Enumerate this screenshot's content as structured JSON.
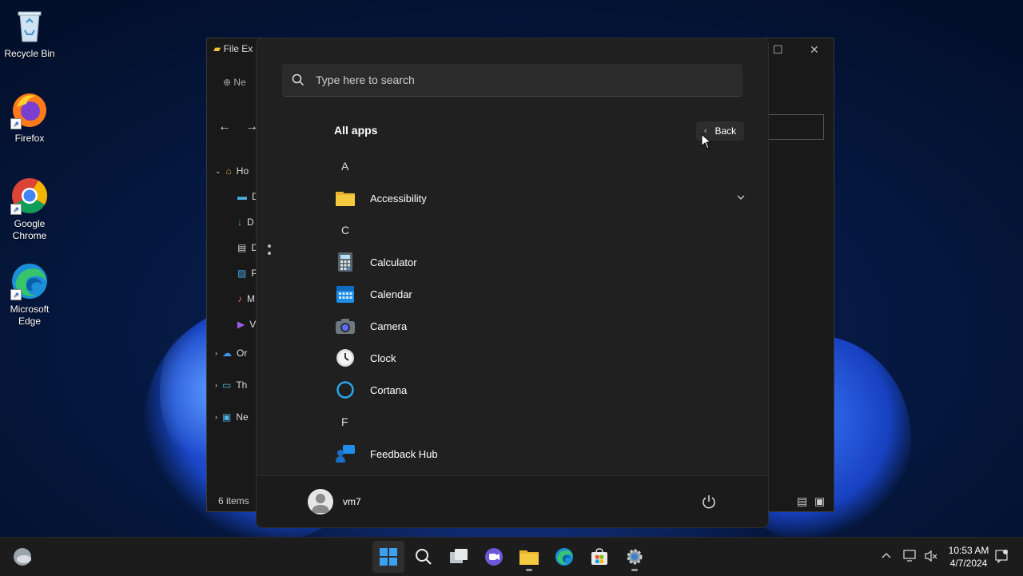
{
  "desktop": {
    "icons": [
      {
        "label": "Recycle Bin",
        "icon": "recycle-bin-icon"
      },
      {
        "label": "Firefox",
        "icon": "firefox-icon"
      },
      {
        "label": "Google Chrome",
        "icon": "chrome-icon"
      },
      {
        "label": "Microsoft Edge",
        "icon": "edge-icon"
      }
    ]
  },
  "explorer": {
    "title": "File Ex",
    "new_label": "Ne",
    "nav_items": [
      "Ho",
      "D",
      "D",
      "D",
      "P",
      "M",
      "V",
      "Or",
      "Th",
      "Ne"
    ],
    "status": "6 items"
  },
  "start_menu": {
    "search": {
      "placeholder": "Type here to search"
    },
    "title": "All apps",
    "back_label": "Back",
    "groups": [
      {
        "letter": "A",
        "apps": [
          {
            "name": "Accessibility",
            "icon": "folder-icon",
            "expandable": true
          }
        ]
      },
      {
        "letter": "C",
        "apps": [
          {
            "name": "Calculator",
            "icon": "calculator-icon"
          },
          {
            "name": "Calendar",
            "icon": "calendar-icon"
          },
          {
            "name": "Camera",
            "icon": "camera-icon"
          },
          {
            "name": "Clock",
            "icon": "clock-icon"
          },
          {
            "name": "Cortana",
            "icon": "cortana-icon"
          }
        ]
      },
      {
        "letter": "F",
        "apps": [
          {
            "name": "Feedback Hub",
            "icon": "feedback-hub-icon"
          }
        ]
      }
    ],
    "user": {
      "name": "vm7"
    }
  },
  "taskbar": {
    "apps": [
      "start",
      "search",
      "task-view",
      "teams-chat",
      "file-explorer",
      "edge",
      "microsoft-store",
      "settings"
    ],
    "time": "10:53 AM",
    "date": "4/7/2024"
  }
}
